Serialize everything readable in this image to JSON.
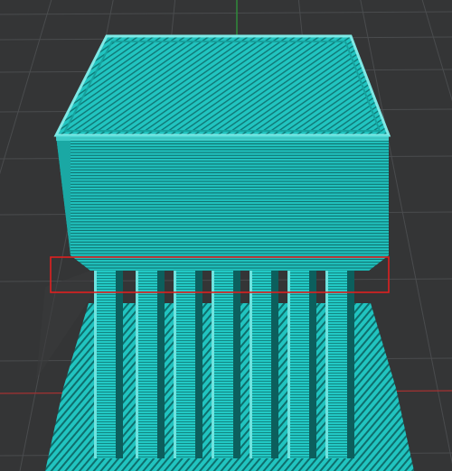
{
  "viewer": {
    "view": "3d-slicer-preview",
    "colors": {
      "background": "#343536",
      "grid_line": "#4a4c4e",
      "axis_y": "#2e8b3a",
      "axis_x": "#a43232",
      "filament": "#21c4c0",
      "filament_dark": "#0f7775",
      "filament_light": "#7fe9e6",
      "highlight_box": "#e02020"
    },
    "highlight": {
      "label": ""
    }
  }
}
